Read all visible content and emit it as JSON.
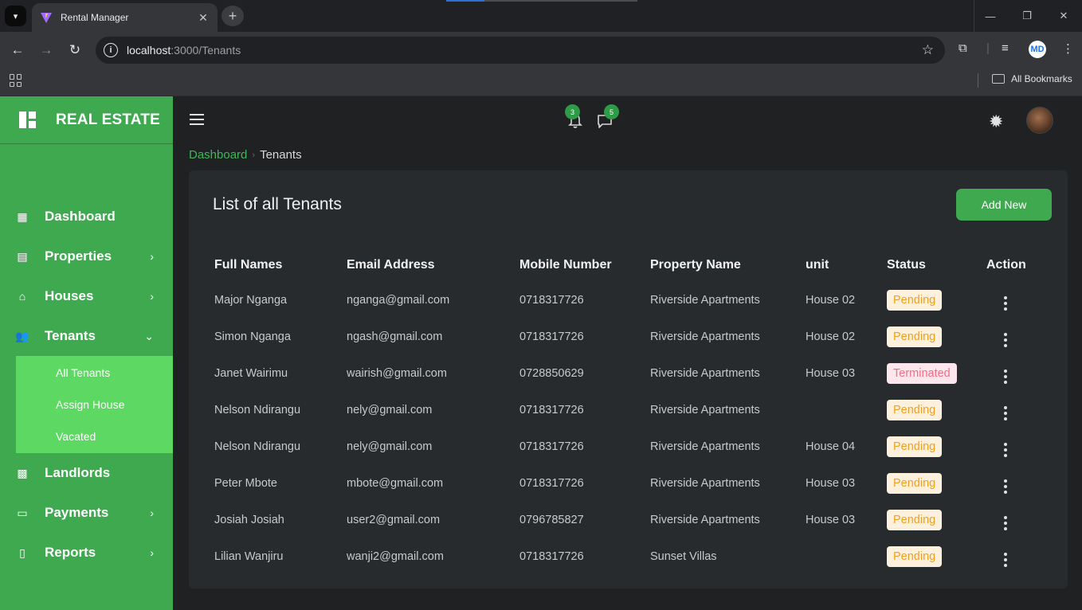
{
  "browser": {
    "tab_title": "Rental Manager",
    "url_host": "localhost",
    "url_path": ":3000/Tenants",
    "bookmarks_label": "All Bookmarks",
    "profile_initials": "MD"
  },
  "sidebar": {
    "brand": "REAL ESTATE",
    "items": [
      {
        "label": "Dashboard",
        "icon": "dashboard-icon",
        "has_chevron": false
      },
      {
        "label": "Properties",
        "icon": "building-icon",
        "has_chevron": true
      },
      {
        "label": "Houses",
        "icon": "home-icon",
        "has_chevron": true
      },
      {
        "label": "Tenants",
        "icon": "users-icon",
        "has_chevron": true,
        "expanded": true
      },
      {
        "label": "Landlords",
        "icon": "landlord-icon",
        "has_chevron": false
      },
      {
        "label": "Payments",
        "icon": "payment-card-icon",
        "has_chevron": true
      },
      {
        "label": "Reports",
        "icon": "report-icon",
        "has_chevron": true
      }
    ],
    "tenants_submenu": [
      "All Tenants",
      "Assign House",
      "Vacated"
    ]
  },
  "topbar": {
    "notification_count": "3",
    "message_count": "5"
  },
  "breadcrumb": {
    "parent": "Dashboard",
    "current": "Tenants"
  },
  "card": {
    "title": "List of all Tenants",
    "add_button": "Add New"
  },
  "table": {
    "headers": [
      "Full Names",
      "Email Address",
      "Mobile Number",
      "Property Name",
      "unit",
      "Status",
      "Action"
    ],
    "rows": [
      {
        "name": "Major Nganga",
        "email": "nganga@gmail.com",
        "mobile": "0718317726",
        "property": "Riverside Apartments",
        "unit": "House 02",
        "status": "Pending"
      },
      {
        "name": "Simon Nganga",
        "email": "ngash@gmail.com",
        "mobile": "0718317726",
        "property": "Riverside Apartments",
        "unit": "House 02",
        "status": "Pending"
      },
      {
        "name": "Janet Wairimu",
        "email": "wairish@gmail.com",
        "mobile": "0728850629",
        "property": "Riverside Apartments",
        "unit": "House 03",
        "status": "Terminated"
      },
      {
        "name": "Nelson Ndirangu",
        "email": "nely@gmail.com",
        "mobile": "0718317726",
        "property": "Riverside Apartments",
        "unit": "",
        "status": "Pending"
      },
      {
        "name": "Nelson Ndirangu",
        "email": "nely@gmail.com",
        "mobile": "0718317726",
        "property": "Riverside Apartments",
        "unit": "House 04",
        "status": "Pending"
      },
      {
        "name": "Peter Mbote",
        "email": "mbote@gmail.com",
        "mobile": "0718317726",
        "property": "Riverside Apartments",
        "unit": "House 03",
        "status": "Pending"
      },
      {
        "name": "Josiah Josiah",
        "email": "user2@gmail.com",
        "mobile": "0796785827",
        "property": "Riverside Apartments",
        "unit": "House 03",
        "status": "Pending"
      },
      {
        "name": "Lilian Wanjiru",
        "email": "wanji2@gmail.com",
        "mobile": "0718317726",
        "property": "Sunset Villas",
        "unit": "",
        "status": "Pending"
      }
    ]
  },
  "colors": {
    "sidebar_green": "#3fa950",
    "submenu_green": "#5dd862",
    "pending_text": "#f0a020",
    "terminated_text": "#f16d88"
  }
}
